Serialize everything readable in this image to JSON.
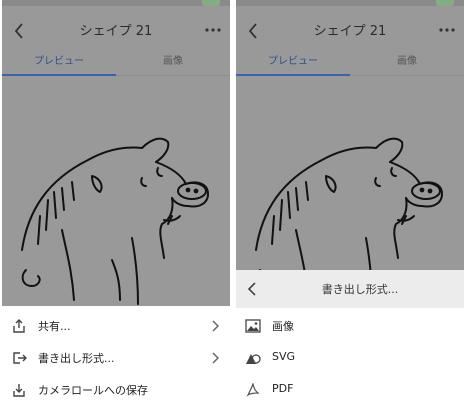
{
  "left": {
    "header": {
      "title": "シェイプ 21",
      "back_icon": "chevron-left-icon",
      "more_icon": "more-horizontal-icon"
    },
    "tabs": [
      {
        "label": "プレビュー",
        "active": true
      },
      {
        "label": "画像",
        "active": false
      }
    ],
    "menu": {
      "items": [
        {
          "label": "共有...",
          "icon": "share-icon",
          "has_submenu": true
        },
        {
          "label": "書き出し形式...",
          "icon": "export-icon",
          "has_submenu": true
        },
        {
          "label": "カメラロールへの保存",
          "icon": "save-to-camera-roll-icon",
          "has_submenu": false
        }
      ]
    }
  },
  "right": {
    "header": {
      "title": "シェイプ 21",
      "back_icon": "chevron-left-icon",
      "more_icon": "more-horizontal-icon"
    },
    "tabs": [
      {
        "label": "プレビュー",
        "active": true
      },
      {
        "label": "画像",
        "active": false
      }
    ],
    "export_sheet": {
      "title": "書き出し形式...",
      "back_icon": "chevron-left-icon",
      "items": [
        {
          "label": "画像",
          "icon": "image-icon"
        },
        {
          "label": "SVG",
          "icon": "svg-shapes-icon"
        },
        {
          "label": "PDF",
          "icon": "pdf-icon"
        }
      ]
    }
  },
  "colors": {
    "overlay": "#999999",
    "accent_blue": "#3a63b0",
    "sheet_bg": "#ffffff",
    "sheet_header_bg": "#ececec"
  }
}
